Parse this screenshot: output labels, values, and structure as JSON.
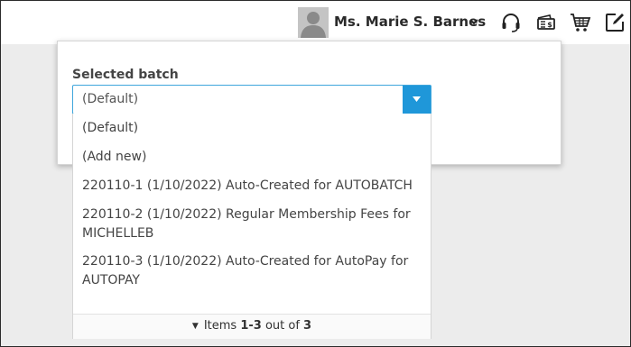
{
  "header": {
    "user_name": "Ms. Marie S. Barnes",
    "icons": [
      "headset-icon",
      "money-icon",
      "cart-icon",
      "edit-icon"
    ]
  },
  "panel": {
    "label": "Selected batch",
    "selected_value": "(Default)"
  },
  "dropdown": {
    "options": [
      {
        "line1": "(Default)",
        "line2": ""
      },
      {
        "line1": "(Add new)",
        "line2": ""
      },
      {
        "line1": "220110-1 (1/10/2022) Auto-Created for AUTOBATCH",
        "line2": ""
      },
      {
        "line1": "220110-2 (1/10/2022) Regular Membership Fees for",
        "line2": "MICHELLEB"
      },
      {
        "line1": "220110-3 (1/10/2022) Auto-Created for AutoPay for",
        "line2": "AUTOPAY"
      }
    ],
    "footer": {
      "prefix": "Items ",
      "range": "1-3",
      "middle": " out of ",
      "total": "3"
    }
  },
  "colors": {
    "accent": "#1f97d9",
    "border_focus": "#3fa6dc",
    "text": "#444444"
  }
}
